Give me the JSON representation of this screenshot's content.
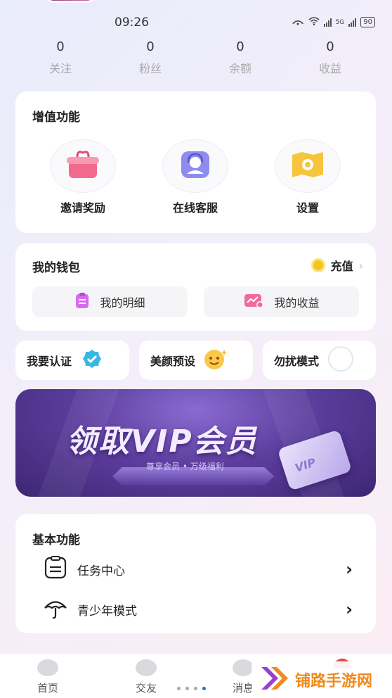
{
  "status_bar": {
    "time": "09:26",
    "battery": "90",
    "network": "5G"
  },
  "stats": [
    {
      "value": "0",
      "label": "关注"
    },
    {
      "value": "0",
      "label": "粉丝"
    },
    {
      "value": "0",
      "label": "余额"
    },
    {
      "value": "0",
      "label": "收益"
    }
  ],
  "value_added": {
    "title": "增值功能",
    "items": [
      {
        "label": "邀请奖励",
        "icon": "gift-box-icon"
      },
      {
        "label": "在线客服",
        "icon": "customer-service-icon"
      },
      {
        "label": "设置",
        "icon": "settings-icon"
      }
    ]
  },
  "wallet": {
    "title": "我的钱包",
    "recharge_label": "充值",
    "buttons": [
      {
        "label": "我的明细",
        "icon": "clipboard-icon"
      },
      {
        "label": "我的收益",
        "icon": "earnings-icon"
      }
    ]
  },
  "quick_actions": [
    {
      "label": "我要认证",
      "icon": "verified-badge-icon"
    },
    {
      "label": "美颜预设",
      "icon": "smiley-face-icon"
    },
    {
      "label": "勿扰模式",
      "icon": "toggle-icon"
    }
  ],
  "vip_banner": {
    "title": "领取VIP会员",
    "subtitle": "尊享会员 • 万级福利",
    "card_text": "VIP"
  },
  "basic": {
    "title": "基本功能",
    "items": [
      {
        "label": "任务中心",
        "icon": "task-list-icon"
      },
      {
        "label": "青少年模式",
        "icon": "umbrella-icon"
      }
    ]
  },
  "tabbar": {
    "tabs": [
      {
        "label": "首页",
        "icon": "home-icon"
      },
      {
        "label": "交友",
        "icon": "heart-icon"
      },
      {
        "label": "消息",
        "icon": "message-icon"
      }
    ]
  },
  "watermark": {
    "text": "铺路手游网"
  },
  "colors": {
    "accent_blue": "#3b6bd8",
    "vip_purple": "#5c3e9e",
    "coin_gold": "#f4c520",
    "watermark_orange": "#f08a1c"
  }
}
